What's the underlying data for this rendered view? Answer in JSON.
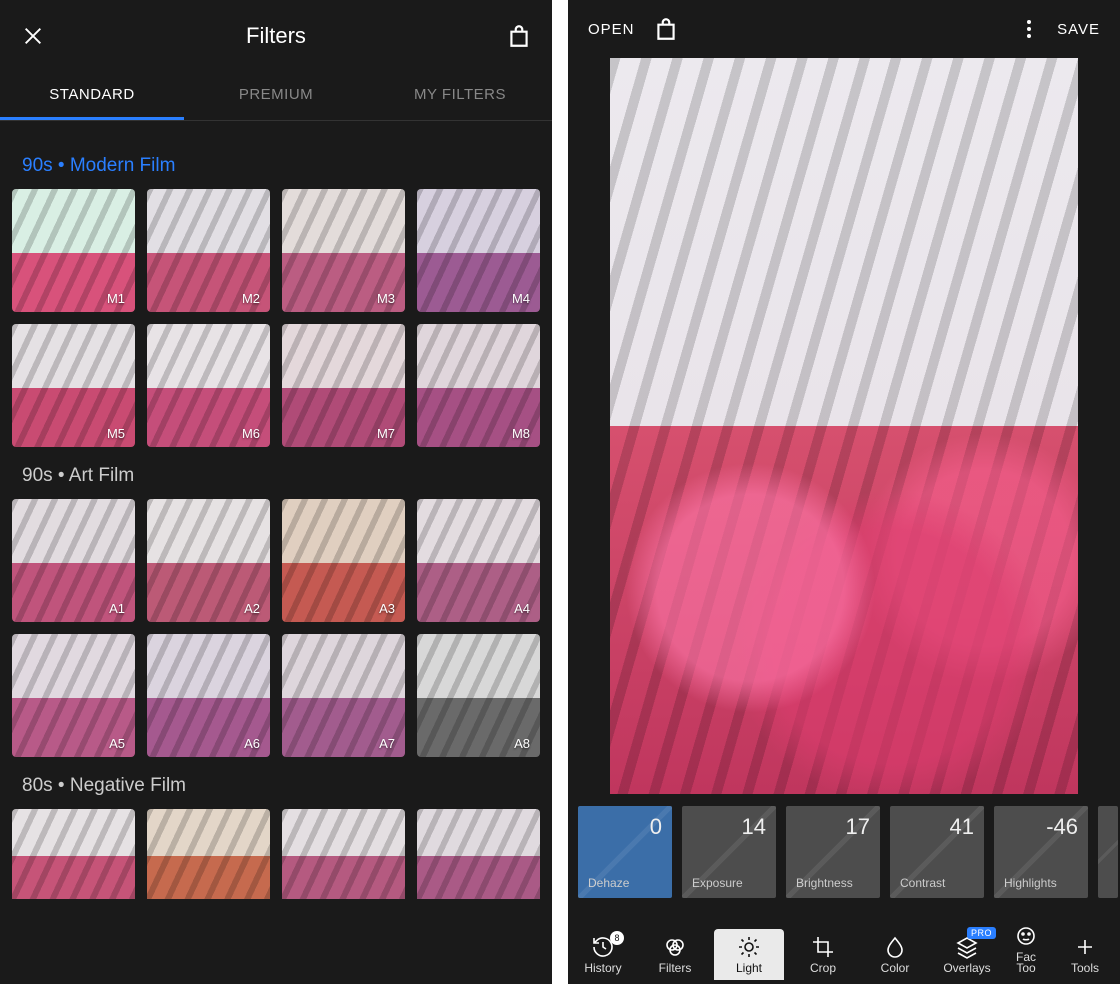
{
  "left": {
    "title": "Filters",
    "tabs": [
      "STANDARD",
      "PREMIUM",
      "MY FILTERS"
    ],
    "active_tab": 0,
    "groups": [
      {
        "title": "90s • Modern Film",
        "accent": true,
        "thumbs": [
          {
            "label": "M1",
            "sky": "#d9efe4",
            "flower": "#d8527b"
          },
          {
            "label": "M2",
            "sky": "#e2dfe4",
            "flower": "#c65478"
          },
          {
            "label": "M3",
            "sky": "#e3dcda",
            "flower": "#bb5d82"
          },
          {
            "label": "M4",
            "sky": "#d7d0df",
            "flower": "#9c5b93"
          },
          {
            "label": "M5",
            "sky": "#e5e1e4",
            "flower": "#c94b72"
          },
          {
            "label": "M6",
            "sky": "#e8e3e6",
            "flower": "#c54e7a"
          },
          {
            "label": "M7",
            "sky": "#e4d8db",
            "flower": "#b04b77"
          },
          {
            "label": "M8",
            "sky": "#e0d6dc",
            "flower": "#a65084"
          }
        ]
      },
      {
        "title": "90s • Art Film",
        "accent": false,
        "thumbs": [
          {
            "label": "A1",
            "sky": "#e2dce0",
            "flower": "#c0547c"
          },
          {
            "label": "A2",
            "sky": "#e6e2e3",
            "flower": "#bc5a76"
          },
          {
            "label": "A3",
            "sky": "#e0cfc0",
            "flower": "#c55a52"
          },
          {
            "label": "A4",
            "sky": "#e3dce0",
            "flower": "#ad5f86"
          },
          {
            "label": "A5",
            "sky": "#e1d9e0",
            "flower": "#b85a88"
          },
          {
            "label": "A6",
            "sky": "#dbd4df",
            "flower": "#a5598f"
          },
          {
            "label": "A7",
            "sky": "#ded6dc",
            "flower": "#a25c8e"
          },
          {
            "label": "A8",
            "sky": "#d8d8d8",
            "flower": "#6a6a6a"
          }
        ]
      },
      {
        "title": "80s • Negative Film",
        "accent": false,
        "thumbs": [
          {
            "label": "",
            "sky": "#e6e2e4",
            "flower": "#c65478"
          },
          {
            "label": "",
            "sky": "#e3d6c8",
            "flower": "#c66a4e"
          },
          {
            "label": "",
            "sky": "#e4dfe2",
            "flower": "#b55a80"
          },
          {
            "label": "",
            "sky": "#e0dadf",
            "flower": "#aa5a86"
          }
        ],
        "truncated": true
      }
    ]
  },
  "right": {
    "open": "OPEN",
    "save": "SAVE",
    "adjustments": [
      {
        "name": "Dehaze",
        "value": "0",
        "active": true
      },
      {
        "name": "Exposure",
        "value": "14"
      },
      {
        "name": "Brightness",
        "value": "17"
      },
      {
        "name": "Contrast",
        "value": "41"
      },
      {
        "name": "Highlights",
        "value": "-46"
      }
    ],
    "history_badge": "8",
    "pro_badge": "PRO",
    "toolbar": [
      {
        "name": "History",
        "icon": "history"
      },
      {
        "name": "Filters",
        "icon": "filters"
      },
      {
        "name": "Light",
        "icon": "light",
        "active": true
      },
      {
        "name": "Crop",
        "icon": "crop"
      },
      {
        "name": "Color",
        "icon": "color"
      },
      {
        "name": "Overlays",
        "icon": "overlays",
        "pro": true
      },
      {
        "name": "Face Tools",
        "icon": "face",
        "truncated_label": "Fac\nToo"
      },
      {
        "name": "Tools",
        "icon": "tools"
      }
    ]
  }
}
